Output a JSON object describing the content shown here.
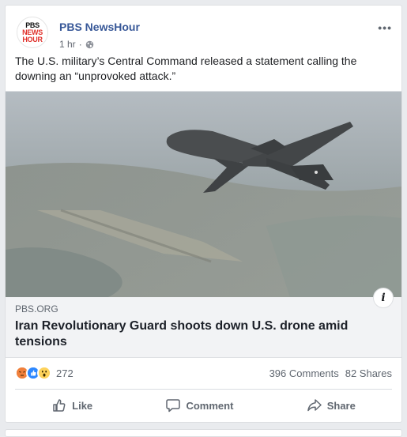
{
  "post": {
    "page_name": "PBS NewsHour",
    "avatar": {
      "line1": "PBS",
      "line2": "NEWS",
      "line3": "HOUR"
    },
    "time": "1 hr",
    "separator": "·",
    "privacy_icon": "globe-icon",
    "more_label": "•••",
    "text": "The U.S. military’s Central Command released a statement calling the downing an “unprovoked attack.”"
  },
  "link": {
    "domain": "PBS.ORG",
    "headline": "Iran Revolutionary Guard shoots down U.S. drone amid tensions",
    "info_label": "i"
  },
  "stats": {
    "reaction_icons": [
      "angry-reaction-icon",
      "like-reaction-icon",
      "wow-reaction-icon"
    ],
    "reaction_count": "272",
    "comments": "396 Comments",
    "shares": "82 Shares"
  },
  "actions": {
    "like": "Like",
    "comment": "Comment",
    "share": "Share"
  },
  "colors": {
    "page_name": "#385898",
    "background": "#e9ebee",
    "link_info_bg": "#f2f3f5",
    "muted": "#606770"
  }
}
